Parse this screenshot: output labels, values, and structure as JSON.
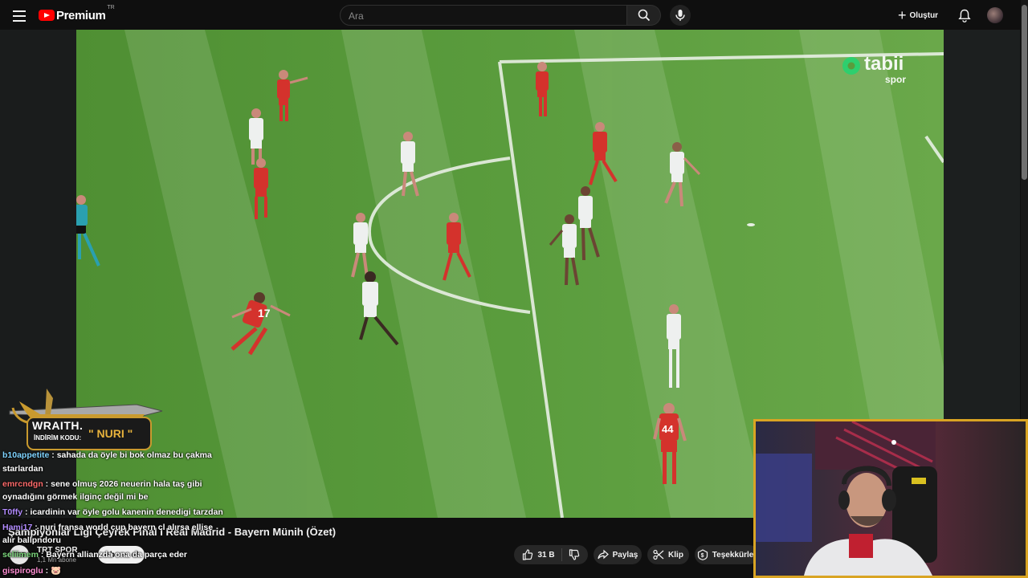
{
  "header": {
    "brand": "Premium",
    "region": "TR",
    "search_placeholder": "Ara",
    "create_label": "Oluştur"
  },
  "video": {
    "title": "Şampiyonlar Ligi Çeyrek Final I Real Madrid - Bayern Münih (Özet)",
    "broadcaster_logo": "tabii",
    "broadcaster_sub": "spor",
    "player_numbers": [
      "17",
      "44"
    ]
  },
  "channel": {
    "avatar_text": "TRT",
    "name": "TRT SPOR",
    "subscribers": "1,1 Mn abone",
    "subscribe_label": "Abone ol"
  },
  "actions": {
    "likes": "31 B",
    "share": "Paylaş",
    "clip": "Klip",
    "thanks": "Teşekkürler"
  },
  "promo": {
    "brand": "WRAITH.",
    "discount_label": "İNDİRİM KODU:",
    "code": "\" NURI \""
  },
  "chat": [
    {
      "user": "b10appetite",
      "color": "#7fd3ff",
      "message": "sahada da öyle bi bok olmaz bu çakma"
    },
    {
      "user": "",
      "color": "#ffffff",
      "message": "starlardan"
    },
    {
      "user": "emrcndgn",
      "color": "#ff6b6b",
      "message": "sene olmuş 2026 neuerin hala taş gibi"
    },
    {
      "user": "",
      "color": "#ffffff",
      "message": "oynadığını görmek ilginç değil mi be"
    },
    {
      "user": "T0ffy",
      "color": "#b38cff",
      "message": "icardinin var öyle golu kanenin denedigi tarzdan"
    },
    {
      "user": "Hami17",
      "color": "#b38cff",
      "message": "nuri fransa world cup bayern cl alırsa ellise"
    },
    {
      "user": "",
      "color": "#ffffff",
      "message": "alır ballpndoru"
    },
    {
      "user": "seliimem",
      "color": "#7dd87d",
      "message": "Bayern allianzda ona da parça eder"
    },
    {
      "user": "gispiroglu",
      "color": "#ff8fd4",
      "message": "🐷"
    }
  ]
}
